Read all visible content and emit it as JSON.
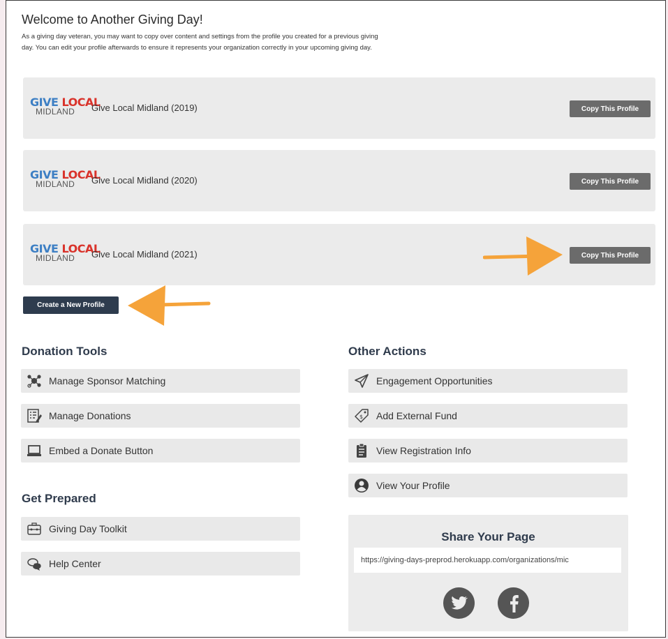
{
  "header": {
    "title": "Welcome to Another Giving Day!",
    "intro_line1": "As a giving day veteran, you may want to copy over content and settings from the profile you created for a previous giving",
    "intro_line2": "day. You can edit your profile afterwards to ensure it represents your organization correctly in your upcoming giving day."
  },
  "logo": {
    "give": "GIVE",
    "local": "LOCAL",
    "midland": "MIDLAND"
  },
  "profiles": [
    {
      "name": "Give Local Midland (2019)",
      "button": "Copy This Profile"
    },
    {
      "name": "Give Local Midland (2020)",
      "button": "Copy This Profile"
    },
    {
      "name": "Give Local Midland (2021)",
      "button": "Copy This Profile"
    }
  ],
  "create_button": "Create a New Profile",
  "donation_tools": {
    "heading": "Donation Tools",
    "items": [
      {
        "label": "Manage Sponsor Matching",
        "icon": "sponsor-network-icon"
      },
      {
        "label": "Manage Donations",
        "icon": "donations-list-icon"
      },
      {
        "label": "Embed a Donate Button",
        "icon": "laptop-icon"
      }
    ]
  },
  "get_prepared": {
    "heading": "Get Prepared",
    "items": [
      {
        "label": "Giving Day Toolkit",
        "icon": "toolkit-icon"
      },
      {
        "label": "Help Center",
        "icon": "chat-bubbles-icon"
      }
    ]
  },
  "other_actions": {
    "heading": "Other Actions",
    "items": [
      {
        "label": "Engagement Opportunities",
        "icon": "paper-plane-icon"
      },
      {
        "label": "Add External Fund",
        "icon": "tag-icon"
      },
      {
        "label": "View Registration Info",
        "icon": "clipboard-icon"
      },
      {
        "label": "View Your Profile",
        "icon": "user-circle-icon"
      }
    ]
  },
  "share": {
    "heading": "Share Your Page",
    "url": "https://giving-days-preprod.herokuapp.com/organizations/mic",
    "social": [
      "twitter-icon",
      "facebook-icon"
    ]
  },
  "colors": {
    "accent_arrow": "#f5a33a",
    "dark_button": "#2e3c4e",
    "copy_button": "#6b6b6b"
  }
}
